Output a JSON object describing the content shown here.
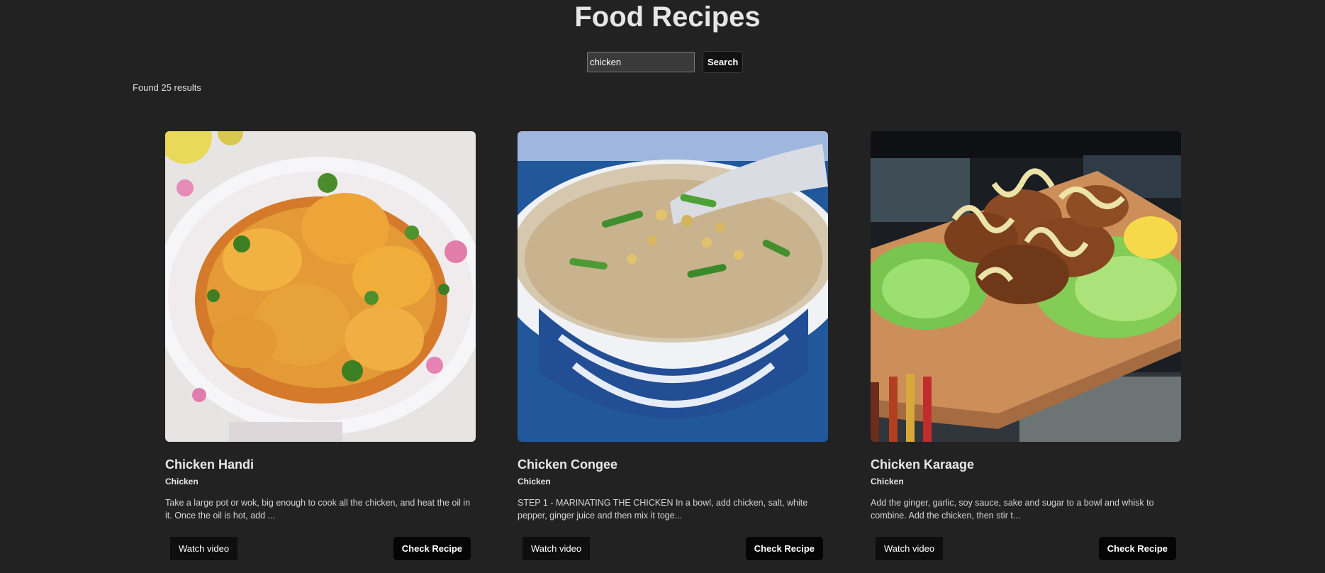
{
  "header": {
    "title": "Food Recipes"
  },
  "search": {
    "value": "chicken",
    "placeholder": "",
    "button_label": "Search"
  },
  "results": {
    "summary": "Found 25 results"
  },
  "cards": [
    {
      "title": "Chicken Handi",
      "category": "Chicken",
      "description": "Take a large pot or wok, big enough to cook all the chicken, and heat the oil in it. Once the oil is hot, add ...",
      "watch_label": "Watch video",
      "check_label": "Check Recipe"
    },
    {
      "title": "Chicken Congee",
      "category": "Chicken",
      "description": "STEP 1 - MARINATING THE CHICKEN In a bowl, add chicken, salt, white pepper, ginger juice and then mix it toge...",
      "watch_label": "Watch video",
      "check_label": "Check Recipe"
    },
    {
      "title": "Chicken Karaage",
      "category": "Chicken",
      "description": "Add the ginger, garlic, soy sauce, sake and sugar to a bowl and whisk to combine. Add the chicken, then stir t...",
      "watch_label": "Watch video",
      "check_label": "Check Recipe"
    }
  ],
  "colors": {
    "background": "#222222",
    "button_background": "#0e0e0e",
    "text": "#e6e6e6"
  }
}
